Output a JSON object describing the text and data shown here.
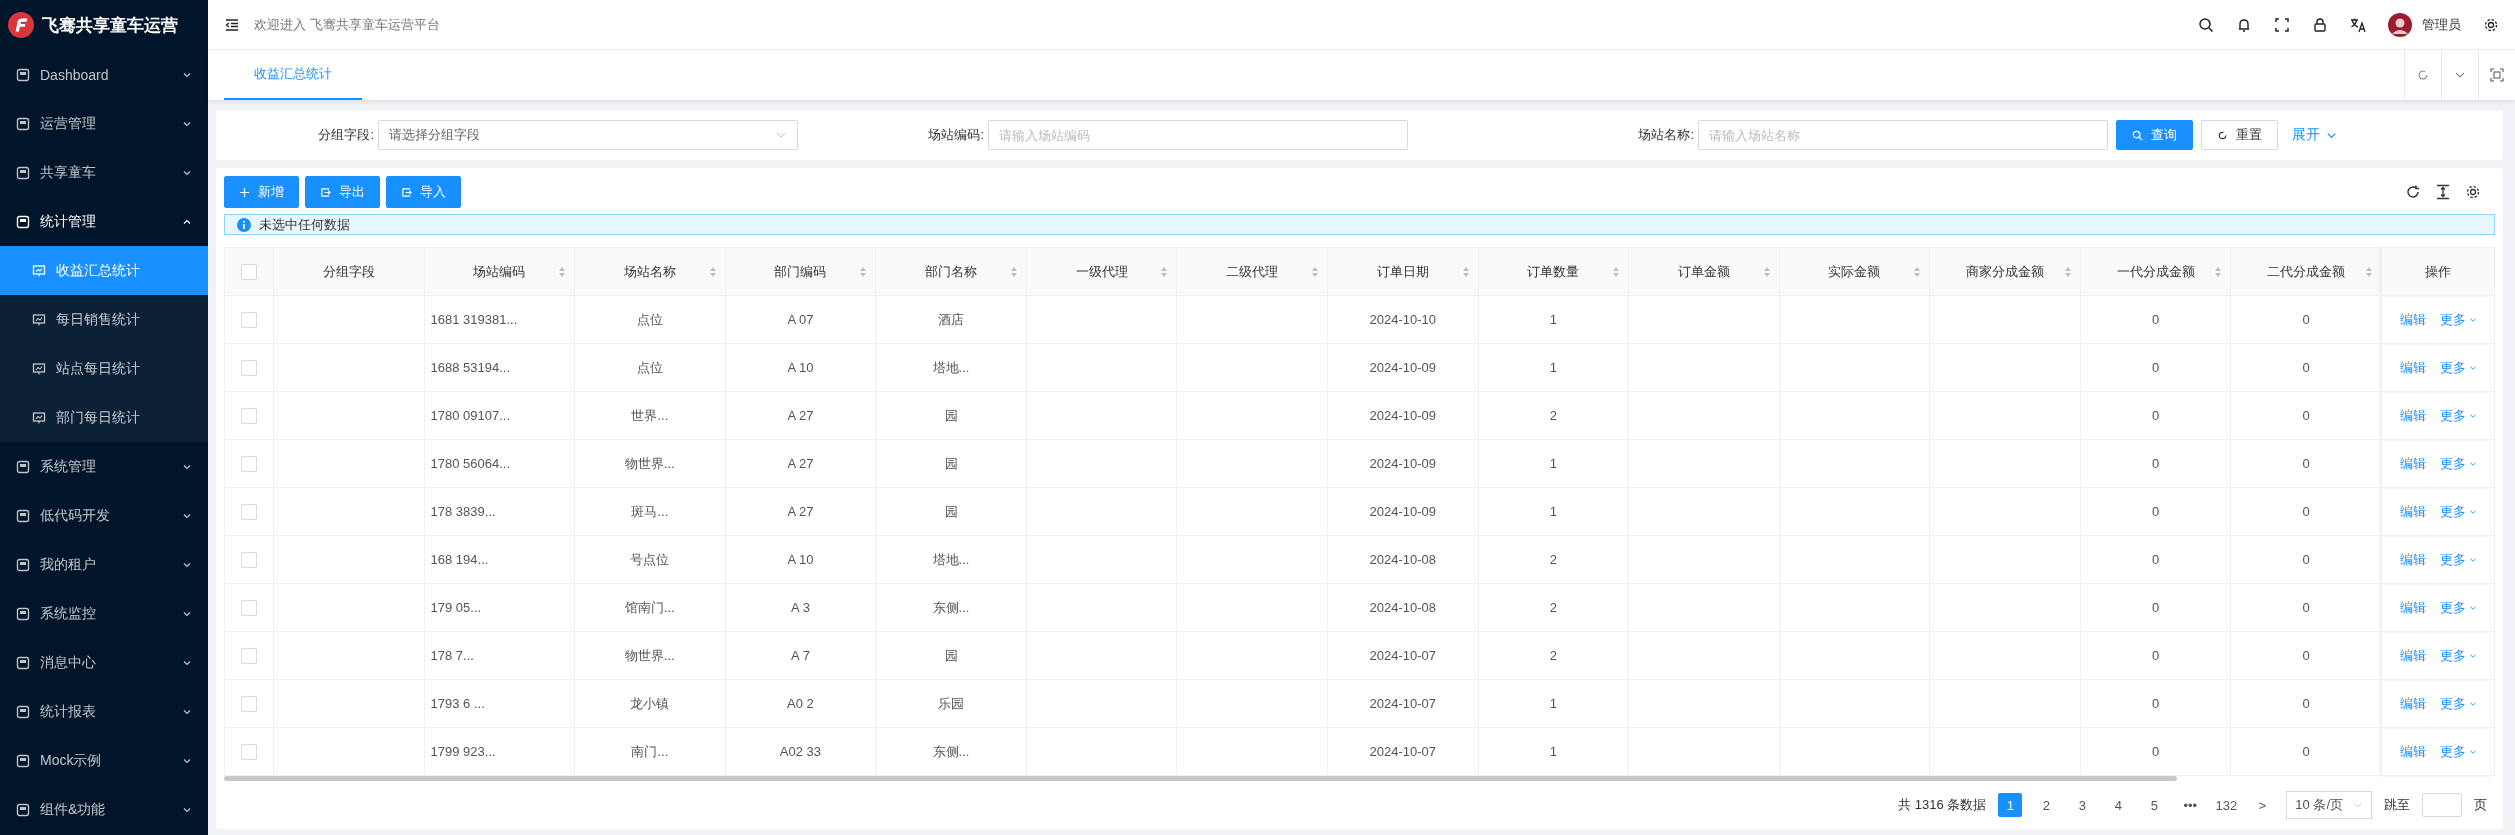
{
  "sidebar": {
    "title": "飞骞共享童车运营",
    "items": [
      {
        "label": "Dashboard",
        "expanded": false
      },
      {
        "label": "运营管理",
        "expanded": false
      },
      {
        "label": "共享童车",
        "expanded": false
      },
      {
        "label": "统计管理",
        "expanded": true,
        "children": [
          {
            "label": "收益汇总统计",
            "selected": true
          },
          {
            "label": "每日销售统计",
            "selected": false
          },
          {
            "label": "站点每日统计",
            "selected": false
          },
          {
            "label": "部门每日统计",
            "selected": false
          }
        ]
      },
      {
        "label": "系统管理",
        "expanded": false
      },
      {
        "label": "低代码开发",
        "expanded": false
      },
      {
        "label": "我的租户",
        "expanded": false
      },
      {
        "label": "系统监控",
        "expanded": false
      },
      {
        "label": "消息中心",
        "expanded": false
      },
      {
        "label": "统计报表",
        "expanded": false
      },
      {
        "label": "Mock示例",
        "expanded": false
      },
      {
        "label": "组件&功能",
        "expanded": false
      }
    ]
  },
  "header": {
    "welcome": "欢迎进入 飞骞共享童车运营平台",
    "user": "管理员"
  },
  "tabs": [
    {
      "label": "收益汇总统计",
      "selected": true
    }
  ],
  "filters": [
    {
      "label": "分组字段:",
      "kind": "select",
      "placeholder": "请选择分组字段"
    },
    {
      "label": "场站编码:",
      "kind": "input",
      "placeholder": "请输入场站编码"
    },
    {
      "label": "场站名称:",
      "kind": "input",
      "placeholder": "请输入场站名称"
    }
  ],
  "filter_buttons": {
    "search": "查询",
    "reset": "重置",
    "expand": "展开"
  },
  "toolbar": [
    {
      "label": "新增",
      "kind": "add"
    },
    {
      "label": "导出",
      "kind": "export"
    },
    {
      "label": "导入",
      "kind": "import"
    }
  ],
  "alert": "未选中任何数据",
  "table": {
    "columns": [
      {
        "title": "分组字段",
        "sortable": false
      },
      {
        "title": "场站编码",
        "sortable": true
      },
      {
        "title": "场站名称",
        "sortable": true
      },
      {
        "title": "部门编码",
        "sortable": true
      },
      {
        "title": "部门名称",
        "sortable": true
      },
      {
        "title": "一级代理",
        "sortable": true
      },
      {
        "title": "二级代理",
        "sortable": true
      },
      {
        "title": "订单日期",
        "sortable": true
      },
      {
        "title": "订单数量",
        "sortable": true
      },
      {
        "title": "订单金额",
        "sortable": true
      },
      {
        "title": "实际金额",
        "sortable": true
      },
      {
        "title": "商家分成金额",
        "sortable": true
      },
      {
        "title": "一代分成金额",
        "sortable": true
      },
      {
        "title": "二代分成金额",
        "sortable": true
      }
    ],
    "select_all_checked": false,
    "action_title": "操作",
    "rows": [
      {
        "checked": false,
        "station_code": "1681 319381...",
        "station_name": "点位",
        "dept_code": "A 07",
        "dept_name": "酒店",
        "order_date": "2024-10-10",
        "order_count": "1",
        "first_share": "0",
        "second_share": "0",
        "actions": [
          "编辑",
          "更多"
        ]
      },
      {
        "checked": false,
        "station_code": "1688 53194...",
        "station_name": "点位",
        "dept_code": "A 10",
        "dept_name": "塔地...",
        "order_date": "2024-10-09",
        "order_count": "1",
        "first_share": "0",
        "second_share": "0",
        "actions": [
          "编辑",
          "更多"
        ]
      },
      {
        "checked": false,
        "station_code": "1780 09107...",
        "station_name": "世界...",
        "dept_code": "A 27",
        "dept_name": "园",
        "order_date": "2024-10-09",
        "order_count": "2",
        "first_share": "0",
        "second_share": "0",
        "actions": [
          "编辑",
          "更多"
        ]
      },
      {
        "checked": false,
        "station_code": "1780 56064...",
        "station_name": "物世界...",
        "dept_code": "A 27",
        "dept_name": "园",
        "order_date": "2024-10-09",
        "order_count": "1",
        "first_share": "0",
        "second_share": "0",
        "actions": [
          "编辑",
          "更多"
        ]
      },
      {
        "checked": false,
        "station_code": "178 3839...",
        "station_name": "斑马...",
        "dept_code": "A 27",
        "dept_name": "园",
        "order_date": "2024-10-09",
        "order_count": "1",
        "first_share": "0",
        "second_share": "0",
        "actions": [
          "编辑",
          "更多"
        ]
      },
      {
        "checked": false,
        "station_code": "168 194...",
        "station_name": "号点位",
        "dept_code": "A 10",
        "dept_name": "塔地...",
        "order_date": "2024-10-08",
        "order_count": "2",
        "first_share": "0",
        "second_share": "0",
        "actions": [
          "编辑",
          "更多"
        ]
      },
      {
        "checked": false,
        "station_code": "179 05...",
        "station_name": "馆南门...",
        "dept_code": "A 3",
        "dept_name": "东侧...",
        "order_date": "2024-10-08",
        "order_count": "2",
        "first_share": "0",
        "second_share": "0",
        "actions": [
          "编辑",
          "更多"
        ]
      },
      {
        "checked": false,
        "station_code": "178 7...",
        "station_name": "物世界...",
        "dept_code": "A 7",
        "dept_name": "园",
        "order_date": "2024-10-07",
        "order_count": "2",
        "first_share": "0",
        "second_share": "0",
        "actions": [
          "编辑",
          "更多"
        ]
      },
      {
        "checked": false,
        "station_code": "1793 6 ...",
        "station_name": "龙小镇",
        "dept_code": "A0 2",
        "dept_name": "乐园",
        "order_date": "2024-10-07",
        "order_count": "1",
        "first_share": "0",
        "second_share": "0",
        "actions": [
          "编辑",
          "更多"
        ]
      },
      {
        "checked": false,
        "station_code": "1799 923...",
        "station_name": "南门...",
        "dept_code": "A02 33",
        "dept_name": "东侧...",
        "order_date": "2024-10-07",
        "order_count": "1",
        "first_share": "0",
        "second_share": "0",
        "actions": [
          "编辑",
          "更多"
        ]
      }
    ]
  },
  "pagination": {
    "total": "共 1316 条数据",
    "pages": [
      {
        "label": "1",
        "selected": true
      },
      {
        "label": "2",
        "selected": false
      },
      {
        "label": "3",
        "selected": false
      },
      {
        "label": "4",
        "selected": false
      },
      {
        "label": "5",
        "selected": false
      },
      {
        "label": "•••",
        "selected": false
      },
      {
        "label": "132",
        "selected": false
      }
    ],
    "next": ">",
    "page_size": "10 条/页",
    "jump_label": "跳至",
    "page_unit": "页"
  }
}
